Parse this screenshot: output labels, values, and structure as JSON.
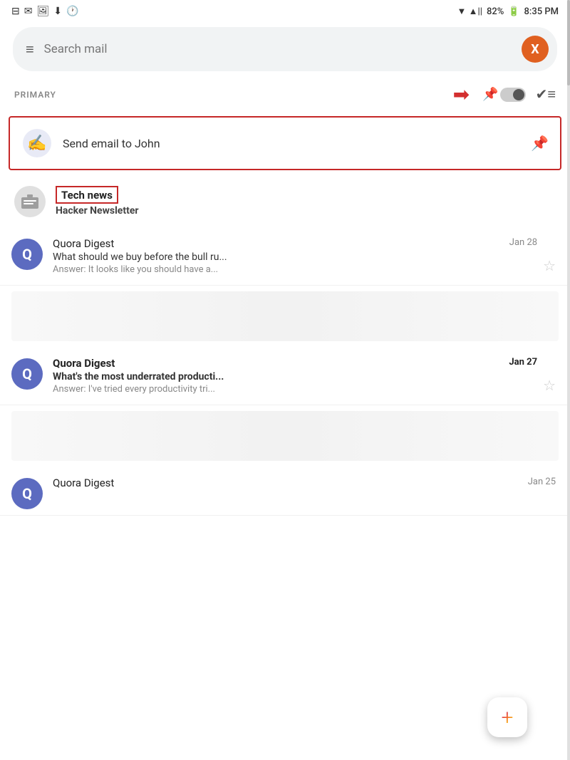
{
  "statusBar": {
    "icons": [
      "⊟",
      "✉",
      "🖼",
      "↓",
      "🕐"
    ],
    "wifi": "▼ .||",
    "battery": "82%",
    "time": "8:35 PM"
  },
  "searchBar": {
    "placeholder": "Search mail",
    "avatarLabel": "X",
    "hamburgerIcon": "≡"
  },
  "primarySection": {
    "label": "PRIMARY"
  },
  "reminderItem": {
    "label": "Send email to John",
    "pinLabel": "📌"
  },
  "techNewsItem": {
    "title": "Tech news",
    "subtitle": "Hacker Newsletter"
  },
  "emails": [
    {
      "sender": "Quora Digest",
      "date": "Jan 28",
      "subject": "What should we buy before the bull ru...",
      "preview": "Answer: It looks like you should have a...",
      "avatarLetter": "Q",
      "bold": false
    },
    {
      "sender": "Quora Digest",
      "date": "Jan 27",
      "subject": "What's the most underrated producti...",
      "preview": "Answer: I've tried every productivity tri...",
      "avatarLetter": "Q",
      "bold": true
    },
    {
      "sender": "Quora Digest",
      "date": "Jan 25",
      "subject": "",
      "preview": "",
      "avatarLetter": "Q",
      "bold": false
    }
  ],
  "fab": {
    "label": "+"
  }
}
